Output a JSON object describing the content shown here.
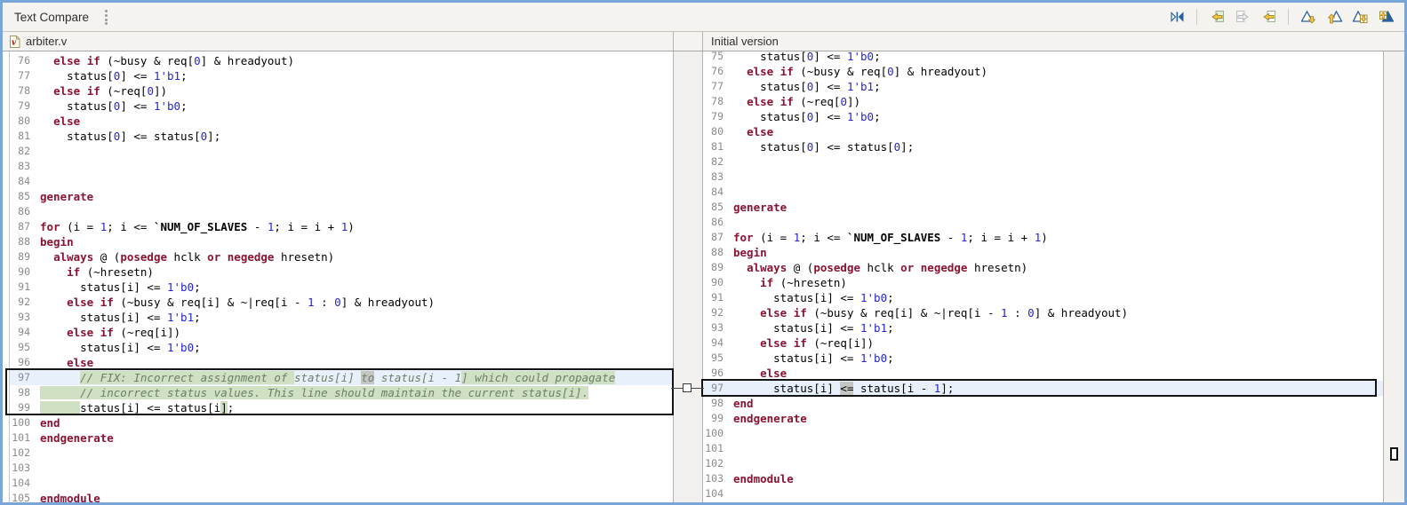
{
  "titlebar": {
    "title": "Text Compare"
  },
  "toolbar": {
    "icons": [
      {
        "name": "swap-left-right-icon",
        "disabled": false
      },
      {
        "name": "copy-all-right-to-left-icon",
        "disabled": false
      },
      {
        "name": "copy-current-left-to-right-icon",
        "disabled": true
      },
      {
        "name": "copy-current-right-to-left-icon",
        "disabled": false
      },
      {
        "name": "next-difference-icon",
        "disabled": false
      },
      {
        "name": "previous-difference-icon",
        "disabled": false
      },
      {
        "name": "next-change-icon",
        "disabled": false
      },
      {
        "name": "previous-change-icon",
        "disabled": false
      }
    ]
  },
  "colors": {
    "keyword": "#8c1232",
    "number": "#2424dd",
    "comment": "#6d7e69",
    "highlight_green": "#cfe0c3",
    "highlight_gray": "#c4c6c3",
    "row_blue": "#e8f1fb",
    "window_border": "#7aa5d8"
  },
  "left_pane": {
    "title": "arbiter.v",
    "file_icon": "verilog-file-icon",
    "lines": [
      {
        "n": 76,
        "segs": [
          [
            "p",
            "  "
          ],
          [
            "k",
            "else if"
          ],
          [
            "p",
            " (~busy & req["
          ],
          [
            "n",
            "0"
          ],
          [
            "p",
            "] & hreadyout)"
          ]
        ]
      },
      {
        "n": 77,
        "segs": [
          [
            "p",
            "    status["
          ],
          [
            "n",
            "0"
          ],
          [
            "p",
            "] <= "
          ],
          [
            "n",
            "1'b1"
          ],
          [
            "p",
            ";"
          ]
        ]
      },
      {
        "n": 78,
        "segs": [
          [
            "p",
            "  "
          ],
          [
            "k",
            "else if"
          ],
          [
            "p",
            " (~req["
          ],
          [
            "n",
            "0"
          ],
          [
            "p",
            "])"
          ]
        ]
      },
      {
        "n": 79,
        "segs": [
          [
            "p",
            "    status["
          ],
          [
            "n",
            "0"
          ],
          [
            "p",
            "] <= "
          ],
          [
            "n",
            "1'b0"
          ],
          [
            "p",
            ";"
          ]
        ]
      },
      {
        "n": 80,
        "segs": [
          [
            "p",
            "  "
          ],
          [
            "k",
            "else"
          ]
        ]
      },
      {
        "n": 81,
        "segs": [
          [
            "p",
            "    status["
          ],
          [
            "n",
            "0"
          ],
          [
            "p",
            "] <= status["
          ],
          [
            "n",
            "0"
          ],
          [
            "p",
            "];"
          ]
        ]
      },
      {
        "n": 82,
        "segs": []
      },
      {
        "n": 83,
        "segs": []
      },
      {
        "n": 84,
        "segs": []
      },
      {
        "n": 85,
        "segs": [
          [
            "k",
            "generate"
          ]
        ]
      },
      {
        "n": 86,
        "segs": []
      },
      {
        "n": 87,
        "segs": [
          [
            "k",
            "for"
          ],
          [
            "p",
            " (i = "
          ],
          [
            "n",
            "1"
          ],
          [
            "p",
            "; i <= "
          ],
          [
            "m",
            "`NUM_OF_SLAVES"
          ],
          [
            "p",
            " - "
          ],
          [
            "n",
            "1"
          ],
          [
            "p",
            "; i = i + "
          ],
          [
            "n",
            "1"
          ],
          [
            "p",
            ")"
          ]
        ]
      },
      {
        "n": 88,
        "segs": [
          [
            "k",
            "begin"
          ]
        ]
      },
      {
        "n": 89,
        "segs": [
          [
            "p",
            "  "
          ],
          [
            "k",
            "always"
          ],
          [
            "p",
            " @ ("
          ],
          [
            "k",
            "posedge"
          ],
          [
            "p",
            " hclk "
          ],
          [
            "k",
            "or"
          ],
          [
            "p",
            " "
          ],
          [
            "k",
            "negedge"
          ],
          [
            "p",
            " hresetn)"
          ]
        ]
      },
      {
        "n": 90,
        "segs": [
          [
            "p",
            "    "
          ],
          [
            "k",
            "if"
          ],
          [
            "p",
            " (~hresetn)"
          ]
        ]
      },
      {
        "n": 91,
        "segs": [
          [
            "p",
            "      status[i] <= "
          ],
          [
            "n",
            "1'b0"
          ],
          [
            "p",
            ";"
          ]
        ]
      },
      {
        "n": 92,
        "segs": [
          [
            "p",
            "    "
          ],
          [
            "k",
            "else if"
          ],
          [
            "p",
            " (~busy & req[i] & ~|req[i - "
          ],
          [
            "n",
            "1"
          ],
          [
            "p",
            " : "
          ],
          [
            "n",
            "0"
          ],
          [
            "p",
            "] & hreadyout)"
          ]
        ]
      },
      {
        "n": 93,
        "segs": [
          [
            "p",
            "      status[i] <= "
          ],
          [
            "n",
            "1'b1"
          ],
          [
            "p",
            ";"
          ]
        ]
      },
      {
        "n": 94,
        "segs": [
          [
            "p",
            "    "
          ],
          [
            "k",
            "else if"
          ],
          [
            "p",
            " (~req[i])"
          ]
        ]
      },
      {
        "n": 95,
        "segs": [
          [
            "p",
            "      status[i] <= "
          ],
          [
            "n",
            "1'b0"
          ],
          [
            "p",
            ";"
          ]
        ]
      },
      {
        "n": 96,
        "segs": [
          [
            "p",
            "    "
          ],
          [
            "k",
            "else"
          ]
        ]
      },
      {
        "n": 97,
        "bg": "blue",
        "segs": [
          [
            "p",
            "      "
          ],
          [
            "cg",
            "// FIX: Incorrect assignment of "
          ],
          [
            "c",
            "status[i] "
          ],
          [
            "cx",
            "to"
          ],
          [
            "c",
            " status[i - 1"
          ],
          [
            "cg",
            "] which could propagate"
          ]
        ]
      },
      {
        "n": 98,
        "segs": [
          [
            "cg",
            "      // incorrect status values. This line should maintain the current status[i]."
          ]
        ]
      },
      {
        "n": 99,
        "segs": [
          [
            "pg",
            "      "
          ],
          [
            "p",
            "status[i] <= status[i"
          ],
          [
            "pg",
            "]"
          ],
          [
            "p",
            ";"
          ]
        ]
      },
      {
        "n": 100,
        "segs": [
          [
            "k",
            "end"
          ]
        ]
      },
      {
        "n": 101,
        "segs": [
          [
            "k",
            "endgenerate"
          ]
        ]
      },
      {
        "n": 102,
        "segs": []
      },
      {
        "n": 103,
        "segs": []
      },
      {
        "n": 104,
        "segs": []
      },
      {
        "n": 105,
        "segs": [
          [
            "k",
            "endmodule"
          ]
        ]
      }
    ]
  },
  "right_pane": {
    "title": "Initial version",
    "lines": [
      {
        "n": 75,
        "segs": [
          [
            "p",
            "    status["
          ],
          [
            "n",
            "0"
          ],
          [
            "p",
            "] <= "
          ],
          [
            "n",
            "1'b0"
          ],
          [
            "p",
            ";"
          ]
        ]
      },
      {
        "n": 76,
        "segs": [
          [
            "p",
            "  "
          ],
          [
            "k",
            "else if"
          ],
          [
            "p",
            " (~busy & req["
          ],
          [
            "n",
            "0"
          ],
          [
            "p",
            "] & hreadyout)"
          ]
        ]
      },
      {
        "n": 77,
        "segs": [
          [
            "p",
            "    status["
          ],
          [
            "n",
            "0"
          ],
          [
            "p",
            "] <= "
          ],
          [
            "n",
            "1'b1"
          ],
          [
            "p",
            ";"
          ]
        ]
      },
      {
        "n": 78,
        "segs": [
          [
            "p",
            "  "
          ],
          [
            "k",
            "else if"
          ],
          [
            "p",
            " (~req["
          ],
          [
            "n",
            "0"
          ],
          [
            "p",
            "])"
          ]
        ]
      },
      {
        "n": 79,
        "segs": [
          [
            "p",
            "    status["
          ],
          [
            "n",
            "0"
          ],
          [
            "p",
            "] <= "
          ],
          [
            "n",
            "1'b0"
          ],
          [
            "p",
            ";"
          ]
        ]
      },
      {
        "n": 80,
        "segs": [
          [
            "p",
            "  "
          ],
          [
            "k",
            "else"
          ]
        ]
      },
      {
        "n": 81,
        "segs": [
          [
            "p",
            "    status["
          ],
          [
            "n",
            "0"
          ],
          [
            "p",
            "] <= status["
          ],
          [
            "n",
            "0"
          ],
          [
            "p",
            "];"
          ]
        ]
      },
      {
        "n": 82,
        "segs": []
      },
      {
        "n": 83,
        "segs": []
      },
      {
        "n": 84,
        "segs": []
      },
      {
        "n": 85,
        "segs": [
          [
            "k",
            "generate"
          ]
        ]
      },
      {
        "n": 86,
        "segs": []
      },
      {
        "n": 87,
        "segs": [
          [
            "k",
            "for"
          ],
          [
            "p",
            " (i = "
          ],
          [
            "n",
            "1"
          ],
          [
            "p",
            "; i <= "
          ],
          [
            "m",
            "`NUM_OF_SLAVES"
          ],
          [
            "p",
            " - "
          ],
          [
            "n",
            "1"
          ],
          [
            "p",
            "; i = i + "
          ],
          [
            "n",
            "1"
          ],
          [
            "p",
            ")"
          ]
        ]
      },
      {
        "n": 88,
        "segs": [
          [
            "k",
            "begin"
          ]
        ]
      },
      {
        "n": 89,
        "segs": [
          [
            "p",
            "  "
          ],
          [
            "k",
            "always"
          ],
          [
            "p",
            " @ ("
          ],
          [
            "k",
            "posedge"
          ],
          [
            "p",
            " hclk "
          ],
          [
            "k",
            "or"
          ],
          [
            "p",
            " "
          ],
          [
            "k",
            "negedge"
          ],
          [
            "p",
            " hresetn)"
          ]
        ]
      },
      {
        "n": 90,
        "segs": [
          [
            "p",
            "    "
          ],
          [
            "k",
            "if"
          ],
          [
            "p",
            " (~hresetn)"
          ]
        ]
      },
      {
        "n": 91,
        "segs": [
          [
            "p",
            "      status[i] <= "
          ],
          [
            "n",
            "1'b0"
          ],
          [
            "p",
            ";"
          ]
        ]
      },
      {
        "n": 92,
        "segs": [
          [
            "p",
            "    "
          ],
          [
            "k",
            "else if"
          ],
          [
            "p",
            " (~busy & req[i] & ~|req[i - "
          ],
          [
            "n",
            "1"
          ],
          [
            "p",
            " : "
          ],
          [
            "n",
            "0"
          ],
          [
            "p",
            "] & hreadyout)"
          ]
        ]
      },
      {
        "n": 93,
        "segs": [
          [
            "p",
            "      status[i] <= "
          ],
          [
            "n",
            "1'b1"
          ],
          [
            "p",
            ";"
          ]
        ]
      },
      {
        "n": 94,
        "segs": [
          [
            "p",
            "    "
          ],
          [
            "k",
            "else if"
          ],
          [
            "p",
            " (~req[i])"
          ]
        ]
      },
      {
        "n": 95,
        "segs": [
          [
            "p",
            "      status[i] <= "
          ],
          [
            "n",
            "1'b0"
          ],
          [
            "p",
            ";"
          ]
        ]
      },
      {
        "n": 96,
        "segs": [
          [
            "p",
            "    "
          ],
          [
            "k",
            "else"
          ]
        ]
      },
      {
        "n": 97,
        "bg": "blue",
        "segs": [
          [
            "p",
            "      status[i] "
          ],
          [
            "px",
            "<="
          ],
          [
            "p",
            " status[i - "
          ],
          [
            "n",
            "1"
          ],
          [
            "p",
            "];"
          ]
        ]
      },
      {
        "n": 98,
        "segs": [
          [
            "k",
            "end"
          ]
        ]
      },
      {
        "n": 99,
        "segs": [
          [
            "k",
            "endgenerate"
          ]
        ]
      },
      {
        "n": 100,
        "segs": []
      },
      {
        "n": 101,
        "segs": []
      },
      {
        "n": 102,
        "segs": []
      },
      {
        "n": 103,
        "segs": [
          [
            "k",
            "endmodule"
          ]
        ]
      },
      {
        "n": 104,
        "segs": []
      }
    ]
  }
}
